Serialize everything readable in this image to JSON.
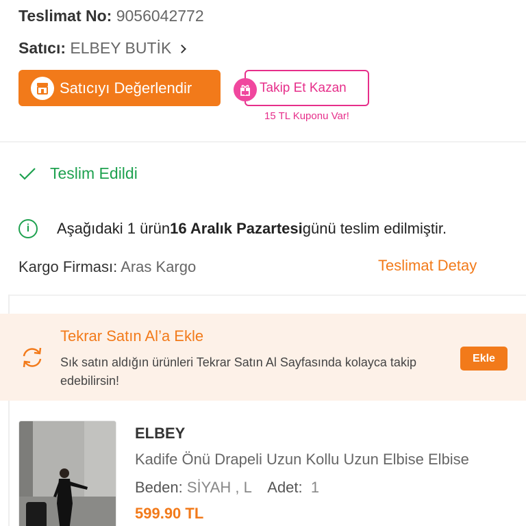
{
  "order": {
    "delivery_no_label": "Teslimat No:",
    "delivery_no": "9056042772",
    "seller_label": "Satıcı:",
    "seller_name": "ELBEY BUTİK"
  },
  "actions": {
    "rate_seller": "Satıcıyı Değerlendir",
    "follow_earn": "Takip Et Kazan",
    "coupon_note": "15 TL Kuponu Var!"
  },
  "status": {
    "label": "Teslim Edildi",
    "info_prefix": "Aşağıdaki 1 ürün ",
    "info_date": "16 Aralık Pazartesi",
    "info_suffix": " günü teslim edilmiştir.",
    "cargo_label": "Kargo Firması:",
    "cargo_name": "Aras Kargo",
    "detail_link": "Teslimat Detay"
  },
  "reorder": {
    "title": "Tekrar Satın Al’a Ekle",
    "description": "Sık satın aldığın ürünleri Tekrar Satın Al Sayfasında kolayca takip edebilirsin!",
    "button": "Ekle"
  },
  "product": {
    "brand": "ELBEY",
    "name": "Kadife Önü Drapeli Uzun Kollu Uzun Elbise Elbise",
    "size_label": "Beden:",
    "size_value": "SİYAH , L",
    "qty_label": "Adet:",
    "qty_value": "1",
    "price": "599.90 TL"
  },
  "colors": {
    "accent": "#f27a1a",
    "success": "#1ea14f",
    "pink": "#e62e8a",
    "banner_bg": "#fdf1e8"
  },
  "icons": [
    "store-icon",
    "gift-icon",
    "checkmark-icon",
    "info-icon",
    "refresh-icon",
    "chevron-right-icon"
  ]
}
